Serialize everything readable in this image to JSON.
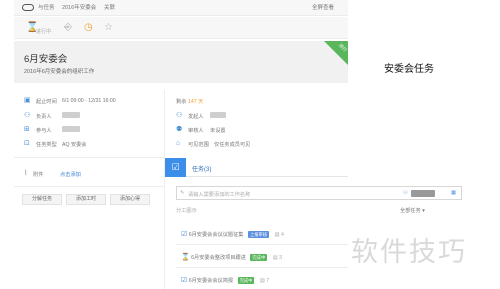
{
  "topbar": {
    "breadcrumb_root": "与任务",
    "breadcrumb_project": "2016年安委会",
    "breadcrumb_link": "关联",
    "right_action": "全屏查看"
  },
  "toolbar": {
    "tools": [
      {
        "icon": "hourglass-icon",
        "label": "进行中"
      },
      {
        "icon": "exit-icon",
        "label": ""
      },
      {
        "icon": "clock-icon",
        "label": ""
      },
      {
        "icon": "star-icon",
        "label": ""
      }
    ]
  },
  "header": {
    "title": "6月安委会",
    "subtitle": "2016年6月安委会的组织工作",
    "ribbon": "进行"
  },
  "details_left": [
    {
      "icon": "calendar-icon",
      "label": "起止时间",
      "value": "6/1 09:00 - 12/31 16:00"
    },
    {
      "icon": "person-icon",
      "label": "负责人",
      "value": ""
    },
    {
      "icon": "plus-square-icon",
      "label": "参与人",
      "value": ""
    },
    {
      "icon": "grid-icon",
      "label": "任务类型",
      "value": "AQ 安委会"
    }
  ],
  "details_right": [
    {
      "icon": "",
      "label": "剩余",
      "value": "147 天"
    },
    {
      "icon": "person-icon",
      "label": "发起人",
      "value": ""
    },
    {
      "icon": "people-icon",
      "label": "审核人",
      "value": "未设置"
    },
    {
      "icon": "lock-icon",
      "label": "可见范围",
      "value": "仅任务成员可见"
    }
  ],
  "attachment": {
    "label": "附件",
    "link": "点击添加"
  },
  "buttons": [
    "分解任务",
    "添加工时",
    "添加心得"
  ],
  "tasks_panel": {
    "title": "任务(3)",
    "input_placeholder": "请输入需要添加的工作名称",
    "filter_label": "全部任务",
    "filter_chevron": "▾",
    "group_label": "分工图示",
    "tasks": [
      {
        "icon": "check-square-icon",
        "name": "6月安委会会议议题征集",
        "badge": "上报审核",
        "badge_color": "#5b8fe0",
        "count": "4"
      },
      {
        "icon": "hourglass-icon",
        "name": "6月安委会整改项目跟进",
        "badge": "完成中",
        "badge_color": "#59b65b",
        "count": "3"
      },
      {
        "icon": "check-square-icon",
        "name": "6月安委会会议简报",
        "badge": "完成中",
        "badge_color": "#59b65b",
        "count": "7"
      }
    ]
  },
  "side_title": "安委会任务",
  "watermark": "软件技巧"
}
